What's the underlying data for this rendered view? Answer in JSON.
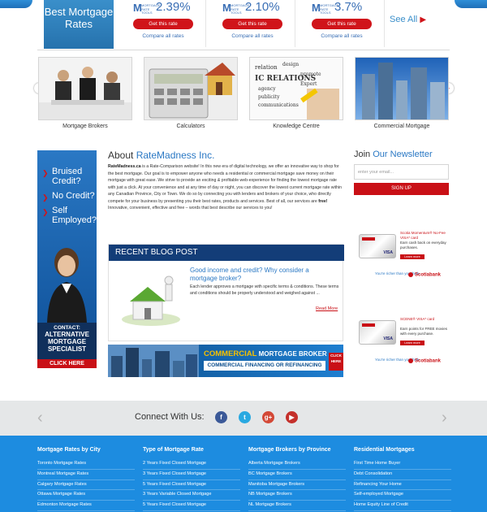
{
  "rates_band": {
    "heading": "Best Mortgage Rates",
    "provider_logo_text": "MORTGAGE RATE TOOLS",
    "rates": [
      {
        "rate": "2.39%",
        "cta": "Get this rate",
        "compare": "Compare all rates"
      },
      {
        "rate": "2.10%",
        "cta": "Get this rate",
        "compare": "Compare all rates"
      },
      {
        "rate": "3.7%",
        "cta": "Get this rate",
        "compare": "Compare all rates"
      }
    ],
    "see_all": "See All"
  },
  "categories": [
    {
      "label": "Mortgage Brokers"
    },
    {
      "label": "Calculators"
    },
    {
      "label": "Knowledge Centre"
    },
    {
      "label": "Commercial Mortgage"
    }
  ],
  "ad": {
    "items": [
      "Bruised Credit?",
      "No Credit?",
      "Self Employed?"
    ],
    "contact_line": "CONTACT:",
    "contact_title": "ALTERNATIVE MORTGAGE SPECIALIST",
    "cta": "CLICK HERE"
  },
  "about": {
    "heading_prefix": "About ",
    "heading_brand": "RateMadness Inc.",
    "site_name": "RateMadness.ca",
    "body": " is a Rate-Comparison website! In this new era of digital technology, we offer an innovative way to shop for the best mortgage. Our goal is to empower anyone who needs a residential or commercial mortgage save money on their mortgage with great ease. We strive to provide an exciting & profitable web-experience for finding the lowest mortgage rate with just a click. At your convenience and at any time of day or night, you can discover the lowest current mortgage rate within any Canadian Province, City or Town. We do so by connecting you with lenders and brokers of your choice, who directly compete for your business by presenting you their best rates, products and services. Best of all, our services are ",
    "free": "free!",
    "tagline": "Innovative, convenient, effective and free – words that best describe our services to you!"
  },
  "blog": {
    "header": "RECENT BLOG POST",
    "title": "Good income and credit? Why consider a mortgage broker?",
    "excerpt": "Each lender approves a mortgage with specific terms & conditions. These terms and conditions should be properly understood and weighed against ...",
    "read_more": "Read More"
  },
  "banner": {
    "title_accent": "COMMERCIAL",
    "title_rest": " MORTGAGE BROKER",
    "subtitle": "COMMERCIAL FINANCING OR REFINANCING",
    "click": "CLICK HERE"
  },
  "newsletter": {
    "heading_prefix": "Join ",
    "heading_accent": "Our Newsletter",
    "placeholder": "enter your email...",
    "button": "SIGN UP"
  },
  "scotia_ads": [
    {
      "card": "Scotia Momentum® No-Fee VISA* card",
      "desc": "Earn cash back on everyday purchases.",
      "learn": "Learn more",
      "richer": "You're richer than you think.",
      "brand": "Scotiabank"
    },
    {
      "card": "SCENE® VISA* card",
      "desc": "Earn points for FREE movies with every purchase.",
      "learn": "Learn more",
      "richer": "You're richer than you think.",
      "brand": "Scotiabank"
    }
  ],
  "connect": {
    "label": "Connect With Us:",
    "networks": [
      {
        "name": "facebook",
        "glyph": "f",
        "color": "#3b5998"
      },
      {
        "name": "twitter",
        "glyph": "t",
        "color": "#29a9e1"
      },
      {
        "name": "google-plus",
        "glyph": "g+",
        "color": "#d34836"
      },
      {
        "name": "youtube",
        "glyph": "▶",
        "color": "#c4302b"
      }
    ]
  },
  "footer": {
    "columns": [
      {
        "heading": "Mortgage Rates by City",
        "links": [
          "Toronto Mortgage Rates",
          "Montreal Mortgage Rates",
          "Calgary Mortgage Rates",
          "Ottawa Mortgage Rates",
          "Edmonton Mortgage Rates"
        ]
      },
      {
        "heading": "Type of Mortgage Rate",
        "links": [
          "2 Years Fixed Closed Mortgage",
          "3 Years Fixed Closed Mortgage",
          "5 Years Fixed Closed Mortgage",
          "3 Years Variable Closed Mortgage",
          "5 Years Fixed Closed Mortgage"
        ]
      },
      {
        "heading": "Mortgage Brokers by Province",
        "links": [
          "Alberta Mortgage Brokers",
          "BC Mortgage Brokers",
          "Manitoba Mortgage Brokers",
          "NB Mortgage Brokers",
          "NL Mortgage Brokers"
        ]
      },
      {
        "heading": "Residential Mortgages",
        "links": [
          "First Time Home Buyer",
          "Debt Consolidation",
          "Refinancing Your Home",
          "Self-employed Mortgage",
          "Home Equity Line of Credit"
        ]
      }
    ]
  }
}
